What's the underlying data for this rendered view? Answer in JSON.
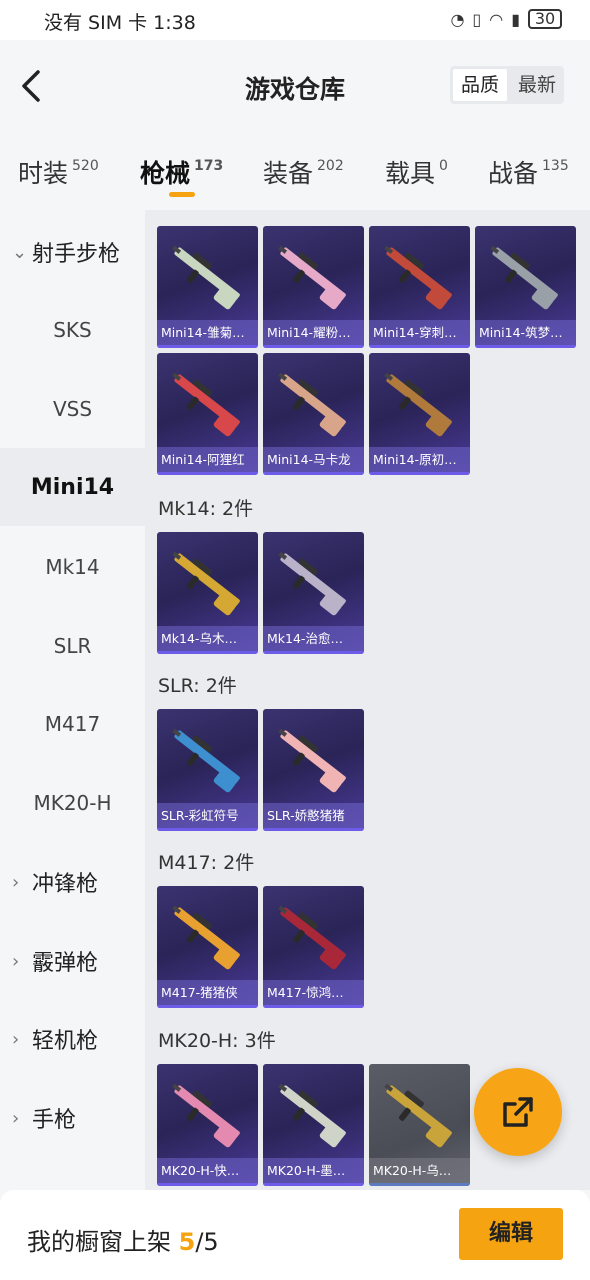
{
  "status_bar": {
    "carrier_time": "没有 SIM 卡 1:38",
    "battery": "30"
  },
  "header": {
    "title": "游戏仓库",
    "sort": {
      "quality": "品质",
      "newest": "最新"
    }
  },
  "tabs": [
    {
      "label": "时装",
      "count": "520"
    },
    {
      "label": "枪械",
      "count": "173"
    },
    {
      "label": "装备",
      "count": "202"
    },
    {
      "label": "载具",
      "count": "0"
    },
    {
      "label": "战备",
      "count": "135"
    }
  ],
  "sidebar": {
    "category_main": "射手步枪",
    "subs": [
      "SKS",
      "VSS",
      "Mini14",
      "Mk14",
      "SLR",
      "M417",
      "MK20-H"
    ],
    "categories": [
      "冲锋枪",
      "霰弹枪",
      "轻机枪",
      "手枪"
    ]
  },
  "sections": {
    "mini14": [
      "Mini14-雏菊…",
      "Mini14-耀粉…",
      "Mini14-穿刺…",
      "Mini14-筑梦…",
      "Mini14-阿狸红",
      "Mini14-马卡龙",
      "Mini14-原初…"
    ],
    "mk14": {
      "title": "Mk14: 2件",
      "items": [
        "Mk14-乌木…",
        "Mk14-治愈…"
      ]
    },
    "slr": {
      "title": "SLR: 2件",
      "items": [
        "SLR-彩虹符号",
        "SLR-娇憨猪猪"
      ]
    },
    "m417": {
      "title": "M417: 2件",
      "items": [
        "M417-猪猪侠",
        "M417-惊鸿…"
      ]
    },
    "mk20": {
      "title": "MK20-H: 3件",
      "items": [
        "MK20-H-快…",
        "MK20-H-墨…",
        "MK20-H-乌…"
      ]
    }
  },
  "bottom": {
    "label": "我的橱窗上架 ",
    "current": "5",
    "total": "/5",
    "edit": "编辑"
  },
  "colors": {
    "accent": "#f5a310",
    "card_bg": "#2a2457"
  }
}
